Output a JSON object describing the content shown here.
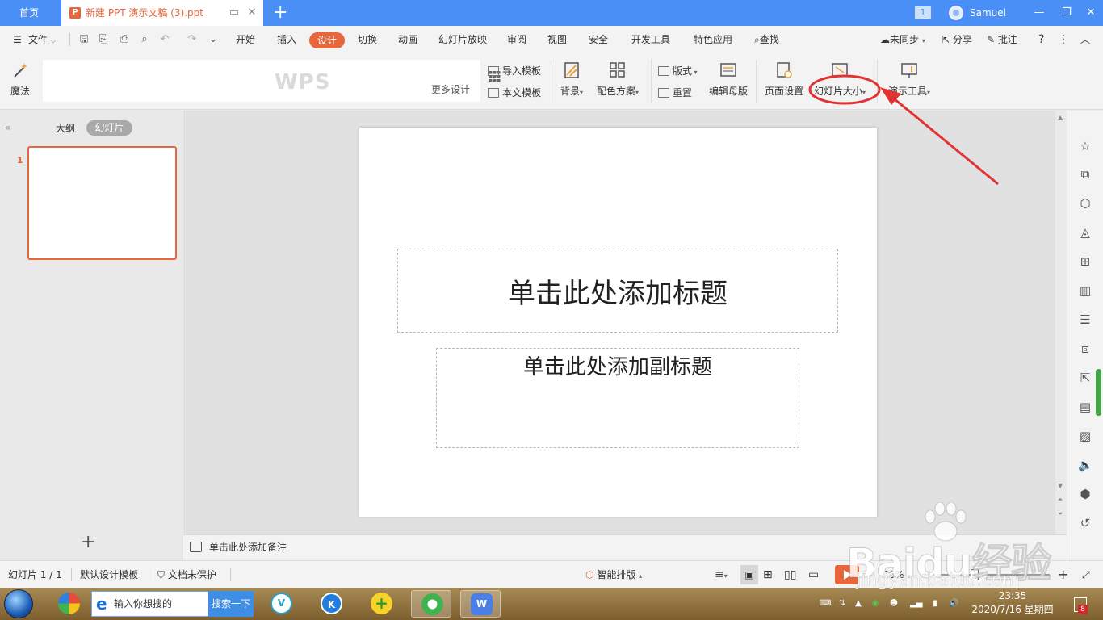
{
  "window": {
    "home_tab": "首页",
    "doc_tab": "新建 PPT 演示文稿 (3).ppt",
    "window_count": "1",
    "username": "Samuel"
  },
  "menu": {
    "file": "文件",
    "items": [
      "开始",
      "插入",
      "设计",
      "切换",
      "动画",
      "幻灯片放映",
      "审阅",
      "视图",
      "安全",
      "开发工具",
      "特色应用"
    ],
    "active": "设计",
    "find": "查找",
    "sync": "未同步",
    "share": "分享",
    "comment": "批注"
  },
  "ribbon": {
    "magic": "魔法",
    "wps_logo": "WPS",
    "more_design": "更多设计",
    "import_template": "导入模板",
    "this_template": "本文模板",
    "background": "背景",
    "color_scheme": "配色方案",
    "layout": "版式",
    "reset": "重置",
    "edit_master": "编辑母版",
    "page_setup": "页面设置",
    "slide_size": "幻灯片大小",
    "present_tools": "演示工具"
  },
  "left_panel": {
    "tab_outline": "大纲",
    "tab_slides": "幻灯片",
    "slide_number": "1"
  },
  "slide": {
    "title_placeholder": "单击此处添加标题",
    "subtitle_placeholder": "单击此处添加副标题"
  },
  "notes": {
    "placeholder": "单击此处添加备注"
  },
  "status": {
    "slide_count": "幻灯片 1 / 1",
    "template": "默认设计模板",
    "protection": "文档未保护",
    "smart_layout": "智能排版",
    "zoom": "66%"
  },
  "taskbar": {
    "search_placeholder": "输入你想搜的",
    "search_button": "搜索一下",
    "time": "23:35",
    "date": "2020/7/16 星期四",
    "notifications": "8"
  },
  "watermark": {
    "brand": "Baidu经验",
    "url": "jingyan.baidu.com"
  },
  "colors": {
    "title_bar": "#4a8ff5",
    "accent": "#e8663b",
    "annotation": "#e23232"
  }
}
